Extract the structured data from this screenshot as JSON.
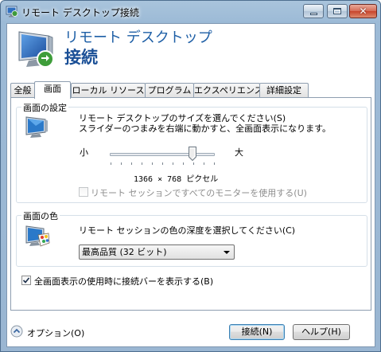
{
  "window": {
    "title": "リモート デスクトップ接続",
    "controls": {
      "minimize": "minimize",
      "maximize": "maximize",
      "close": "✕"
    }
  },
  "header": {
    "subtitle": "リモート デスクトップ",
    "title": "接続"
  },
  "tabs": [
    {
      "label": "全般",
      "active": false
    },
    {
      "label": "画面",
      "active": true
    },
    {
      "label": "ローカル リソース",
      "active": false
    },
    {
      "label": "プログラム",
      "active": false
    },
    {
      "label": "エクスペリエンス",
      "active": false
    },
    {
      "label": "詳細設定",
      "active": false
    }
  ],
  "display_settings": {
    "group_title": "画面の設定",
    "description_line1": "リモート デスクトップのサイズを選んでください(S)",
    "description_line2": "スライダーのつまみを右端に動かすと、全画面表示になります。",
    "slider_min_label": "小",
    "slider_max_label": "大",
    "slider_position_fraction": 0.79,
    "resolution_text": "1366 × 768 ピクセル",
    "all_monitors_label": "リモート セッションですべてのモニターを使用する(U)",
    "all_monitors_checked": false,
    "all_monitors_enabled": false
  },
  "colors": {
    "group_title": "画面の色",
    "description": "リモート セッションの色の深度を選択してください(C)",
    "selected": "最高品質 (32 ビット)"
  },
  "connection_bar": {
    "label": "全画面表示の使用時に接続バーを表示する(B)",
    "checked": true
  },
  "footer": {
    "options_label": "オプション(O)",
    "connect_label": "接続(N)",
    "help_label": "ヘルプ(H)"
  },
  "theme": {
    "title_text_color": "#1e5fa6",
    "frame_color": "#9cbad6"
  }
}
